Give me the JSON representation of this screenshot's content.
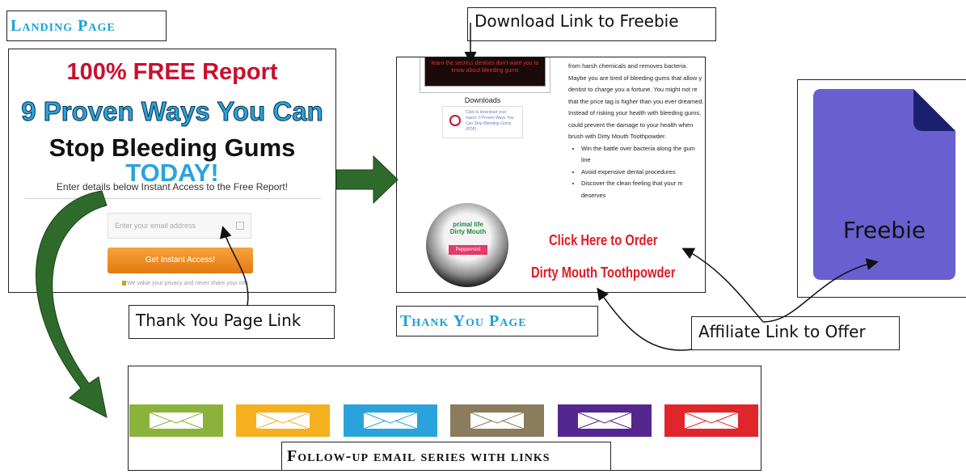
{
  "landing": {
    "section_title": "Landing Page",
    "headline_1": "100% FREE Report",
    "headline_2": "9 Proven Ways You Can",
    "headline_3a": "Stop Bleeding Gums ",
    "headline_3b": "TODAY!",
    "subtext": "Enter details below Instant Access to the Free Report!",
    "email_placeholder": "Enter your email address",
    "button_label": "Get Instant Access!",
    "privacy_note": "We value your privacy and never share your info"
  },
  "thank_you": {
    "section_title": "Thank You Page",
    "banner_text": "learn the secrets dentists don't want you to know about bleeding gums",
    "downloads_title": "Downloads",
    "download_card_text": "Click to download your report: 9 Proven Ways You Can Stop Bleeding Gums (PDF)",
    "jar_brand": "primal life",
    "jar_product": "Dirty Mouth",
    "jar_tag": "Peppermint",
    "body_lines": [
      "from harsh chemicals and removes bacteria.",
      "Maybe you are tired of bleeding gums that allow y",
      "dentist to charge you a fortune. You might not re",
      "that the price tag is higher than you ever dreamed.",
      "Instead of risking your health with bleeding gums,",
      "could prevent the damage to your health when",
      "brush with Dirty Mouth Toothpowder."
    ],
    "bullets": [
      "Win the battle over bacteria along the gum line",
      "Avoid expensive dental procedures",
      "Discover the clean feeling that your m deserves"
    ],
    "cta_line_1": "Click Here to Order",
    "cta_line_2": "Dirty Mouth Toothpowder"
  },
  "freebie": {
    "label": "Freebie",
    "doc_color": "#6a5fd0",
    "fold_color": "#1b1f6e"
  },
  "callouts": {
    "download_link": "Download Link to Freebie",
    "thank_you_link": "Thank You Page Link",
    "affiliate_link": "Affiliate Link to Offer"
  },
  "email_series": {
    "label": "Follow-up email series with links",
    "colors": [
      "#8bb33c",
      "#f5b020",
      "#2aa3dc",
      "#8a7c5c",
      "#54278f",
      "#e0262b"
    ]
  },
  "arrow_color": "#2e6b2a"
}
